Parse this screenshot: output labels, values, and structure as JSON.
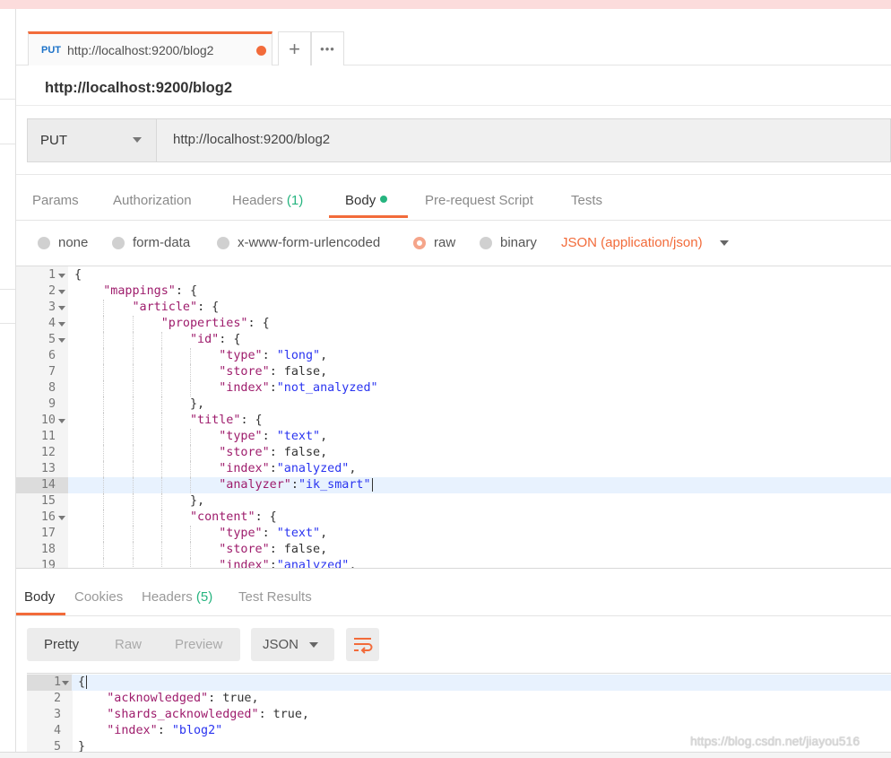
{
  "tab": {
    "method": "PUT",
    "url": "http://localhost:9200/blog2",
    "unsaved": true
  },
  "tab_actions": {
    "new": "+",
    "more": "•••"
  },
  "request_title": "http://localhost:9200/blog2",
  "method_select": "PUT",
  "url_input": "http://localhost:9200/blog2",
  "request_tabs": [
    {
      "label": "Params"
    },
    {
      "label": "Authorization"
    },
    {
      "label": "Headers",
      "count": "(1)"
    },
    {
      "label": "Body",
      "active": true
    },
    {
      "label": "Pre-request Script"
    },
    {
      "label": "Tests"
    }
  ],
  "body_modes": [
    {
      "label": "none",
      "selected": false
    },
    {
      "label": "form-data",
      "selected": false
    },
    {
      "label": "x-www-form-urlencoded",
      "selected": false
    },
    {
      "label": "raw",
      "selected": true
    },
    {
      "label": "binary",
      "selected": false
    }
  ],
  "content_type": "JSON (application/json)",
  "request_body": [
    "{",
    "    \"mappings\": {",
    "        \"article\": {",
    "            \"properties\": {",
    "                \"id\": {",
    "                    \"type\": \"long\",",
    "                    \"store\": false,",
    "                    \"index\":\"not_analyzed\"",
    "                },",
    "                \"title\": {",
    "                    \"type\": \"text\",",
    "                    \"store\": false,",
    "                    \"index\":\"analyzed\",",
    "                    \"analyzer\":\"ik_smart\"",
    "                },",
    "                \"content\": {",
    "                    \"type\": \"text\",",
    "                    \"store\": false,",
    "                    \"index\":\"analyzed\","
  ],
  "request_body_folds": [
    1,
    2,
    3,
    4,
    5,
    10,
    16
  ],
  "active_line": 14,
  "response_tabs": [
    {
      "label": "Body",
      "active": true
    },
    {
      "label": "Cookies"
    },
    {
      "label": "Headers",
      "count": "(5)"
    },
    {
      "label": "Test Results"
    }
  ],
  "response_view": {
    "pretty": "Pretty",
    "raw": "Raw",
    "preview": "Preview",
    "format": "JSON"
  },
  "response_body": [
    "{",
    "    \"acknowledged\": true,",
    "    \"shards_acknowledged\": true,",
    "    \"index\": \"blog2\"",
    "}"
  ],
  "watermark": "https://blog.csdn.net/jiayou516",
  "colors": {
    "accent": "#f26b3a",
    "green": "#26b47f",
    "key": "#9e1c6c",
    "string": "#2a34f0"
  }
}
